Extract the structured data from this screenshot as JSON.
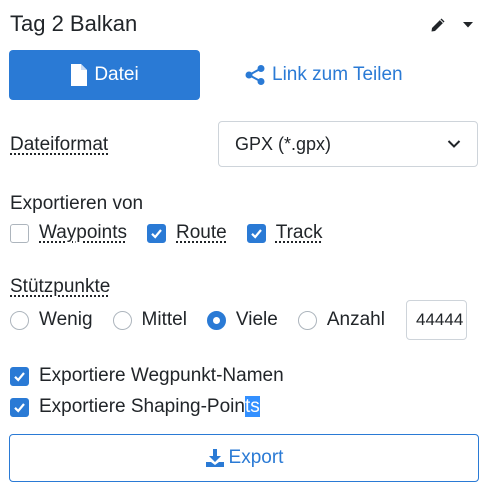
{
  "header": {
    "title": "Tag 2 Balkan",
    "edit_icon": "pencil-icon",
    "menu_icon": "caret-down-icon"
  },
  "tabs": {
    "file_label": "Datei",
    "file_icon": "file-icon",
    "share_label": "Link zum Teilen",
    "share_icon": "share-icon"
  },
  "format": {
    "label": "Dateiformat",
    "selected": "GPX (*.gpx)"
  },
  "export_from": {
    "label": "Exportieren von",
    "options": [
      {
        "label": "Waypoints",
        "checked": false
      },
      {
        "label": "Route",
        "checked": true
      },
      {
        "label": "Track",
        "checked": true
      }
    ]
  },
  "support_points": {
    "label": "Stützpunkte",
    "options": [
      {
        "label": "Wenig",
        "selected": false
      },
      {
        "label": "Mittel",
        "selected": false
      },
      {
        "label": "Viele",
        "selected": true
      },
      {
        "label": "Anzahl",
        "selected": false
      }
    ],
    "count_value": "44444"
  },
  "extras": [
    {
      "label_main": "Exportiere Wegpunkt-Namen",
      "label_sel": "",
      "checked": true
    },
    {
      "label_main": "Exportiere Shaping-Poin",
      "label_sel": "ts",
      "checked": true
    }
  ],
  "export_button": {
    "label": "Export",
    "icon": "download-icon"
  },
  "colors": {
    "accent": "#2a7ad5",
    "text": "#212529",
    "border": "#ced4da"
  }
}
